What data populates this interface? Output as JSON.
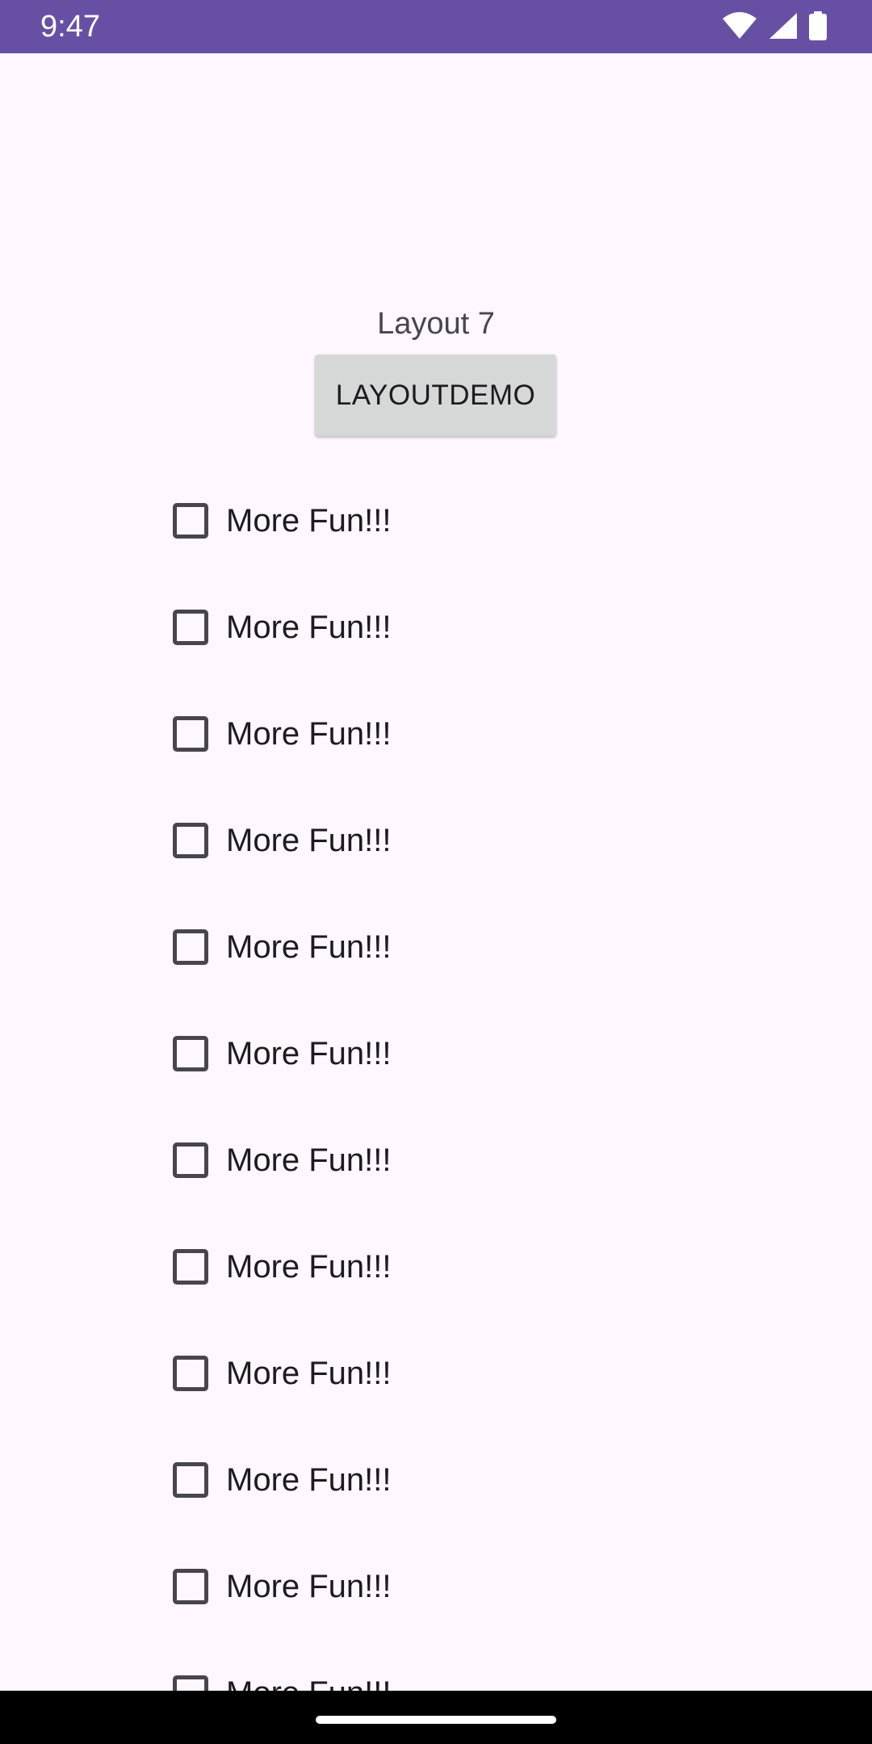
{
  "status_bar": {
    "time": "9:47",
    "icons": [
      "wifi-icon",
      "cell-signal-icon",
      "battery-icon"
    ],
    "background": "#6750A4"
  },
  "main": {
    "title": "Layout 7",
    "button_label": "LAYOUTDEMO",
    "checkboxes": [
      {
        "label": "More Fun!!!",
        "checked": false
      },
      {
        "label": "More Fun!!!",
        "checked": false
      },
      {
        "label": "More Fun!!!",
        "checked": false
      },
      {
        "label": "More Fun!!!",
        "checked": false
      },
      {
        "label": "More Fun!!!",
        "checked": false
      },
      {
        "label": "More Fun!!!",
        "checked": false
      },
      {
        "label": "More Fun!!!",
        "checked": false
      },
      {
        "label": "More Fun!!!",
        "checked": false
      },
      {
        "label": "More Fun!!!",
        "checked": false
      },
      {
        "label": "More Fun!!!",
        "checked": false
      },
      {
        "label": "More Fun!!!",
        "checked": false
      },
      {
        "label": "More Fun!!!",
        "checked": false
      }
    ]
  },
  "colors": {
    "background": "#FEF7FF",
    "button": "#D6D7D7",
    "text": "#1D1B20",
    "nav_bar": "#000000"
  }
}
